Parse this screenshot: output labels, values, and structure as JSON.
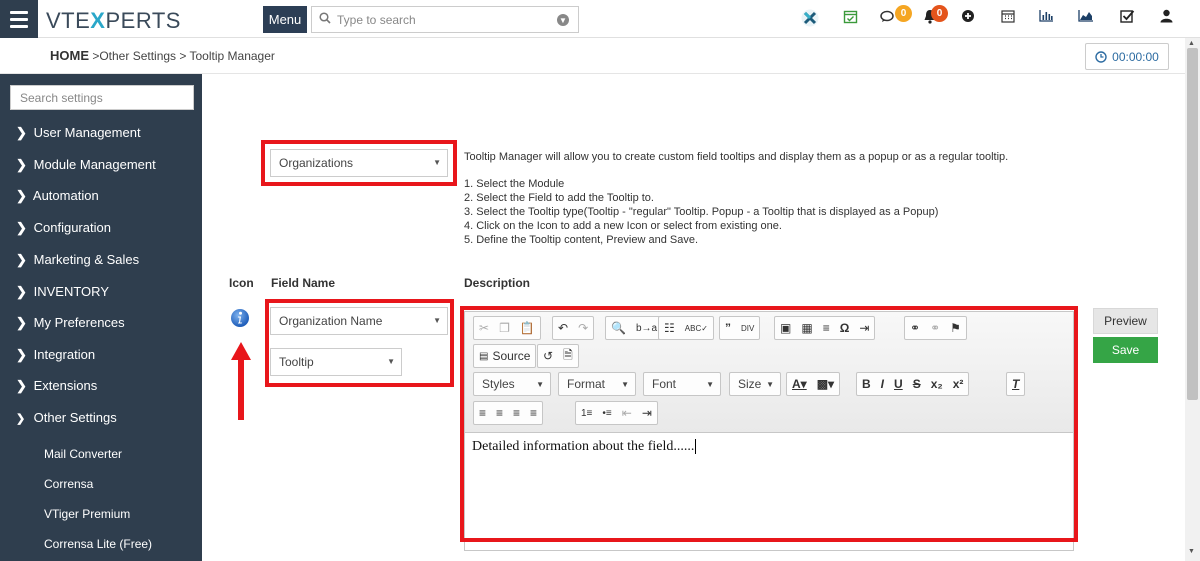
{
  "app": {
    "logo": "VTEXPERTS",
    "menu_label": "Menu",
    "search_placeholder": "Type to search",
    "timer": "00:00:00"
  },
  "topbar": {
    "icons": [
      "vtx-x-icon",
      "calendar-check-icon",
      "comments-icon",
      "bell-icon",
      "plus-circle-icon",
      "calendar-icon",
      "bar-chart-icon",
      "area-chart-icon",
      "checkbox-icon",
      "user-icon"
    ],
    "comments_badge": "0",
    "bell_badge": "0",
    "badge_color": "#f5a623",
    "bell_badge_color": "#e4541b"
  },
  "breadcrumb": {
    "home": "HOME",
    "path": " >Other Settings >  Tooltip Manager"
  },
  "sidebar": {
    "search_placeholder": "Search settings",
    "items": [
      {
        "label": "User Management",
        "expanded": false
      },
      {
        "label": "Module Management",
        "expanded": false
      },
      {
        "label": "Automation",
        "expanded": false
      },
      {
        "label": "Configuration",
        "expanded": false
      },
      {
        "label": "Marketing & Sales",
        "expanded": false
      },
      {
        "label": "INVENTORY",
        "expanded": false
      },
      {
        "label": "My Preferences",
        "expanded": false
      },
      {
        "label": "Integration",
        "expanded": false
      },
      {
        "label": "Extensions",
        "expanded": false
      },
      {
        "label": "Other Settings",
        "expanded": true
      }
    ],
    "subitems": [
      "Mail Converter",
      "Corrensa",
      "VTiger Premium",
      "Corrensa Lite (Free)"
    ]
  },
  "main": {
    "module_select": "Organizations",
    "info_text": "Tooltip Manager will allow you to create custom field tooltips and display them as a popup or as a regular tooltip.",
    "steps": [
      "1. Select the Module",
      "2. Select the Field to add the Tooltip to.",
      "3. Select the Tooltip type(Tooltip - \"regular\" Tooltip. Popup - a Tooltip that is displayed as a Popup)",
      "4. Click on the Icon to add a new Icon or select from existing one.",
      "5. Define the Tooltip content, Preview and Save."
    ],
    "col_icon": "Icon",
    "col_field": "Field Name",
    "col_desc": "Description",
    "field_select": "Organization Name",
    "type_select": "Tooltip",
    "editor": {
      "source_label": "Source",
      "styles": "Styles",
      "format": "Format",
      "font": "Font",
      "size": "Size",
      "content": "Detailed information about the field......"
    },
    "preview_label": "Preview",
    "save_label": "Save",
    "highlight_color": "#e8161b",
    "save_color": "#35a546"
  }
}
